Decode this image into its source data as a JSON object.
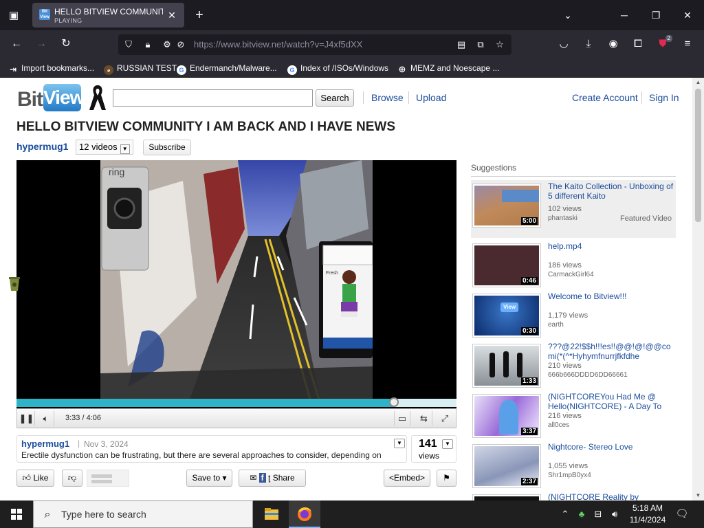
{
  "browser": {
    "tab": {
      "title": "HELLO BITVIEW COMMUNITY I AM BACK AND I HAVE NEWS",
      "status": "PLAYING",
      "favicon_text": "Bit View"
    },
    "url": "https://www.bitview.net/watch?v=J4xf5dXX",
    "extension_badge": "2",
    "bookmarks": [
      {
        "label": "Import bookmarks...",
        "icon": "import-icon"
      },
      {
        "label": "RUSSIAN TEST",
        "icon": "bear-icon"
      },
      {
        "label": "Endermanch/Malware...",
        "icon": "google-icon"
      },
      {
        "label": "Index of /ISOs/Windows",
        "icon": "google-icon"
      },
      {
        "label": "MEMZ and Noescape ...",
        "icon": "globe-icon"
      }
    ]
  },
  "site": {
    "logo_bit": "Bit",
    "logo_view": "View",
    "search_button": "Search",
    "nav": {
      "browse": "Browse",
      "upload": "Upload",
      "create_account": "Create Account",
      "sign_in": "Sign In"
    }
  },
  "video": {
    "title": "HELLO BITVIEW COMMUNITY I AM BACK AND I HAVE NEWS",
    "uploader": "hypermug1",
    "video_count": "12 videos",
    "subscribe": "Subscribe",
    "timecode": "3:33 / 4:06",
    "progress_fraction": 0.858,
    "upload_date": "Nov 3, 2024",
    "description": "Erectile dysfunction can be frustrating, but there are several approaches to consider, depending on",
    "views": "141",
    "views_label": "views",
    "overlay_text": {
      "ring": "ring",
      "fresh": "Fresh"
    }
  },
  "actions": {
    "like": "Like",
    "save_to": "Save to",
    "share": "Share",
    "embed": "<Embed>"
  },
  "suggestions": {
    "heading": "Suggestions",
    "items": [
      {
        "title": "The Kaito Collection - Unboxing of 5 different Kaito",
        "views": "102 views",
        "user": "phantaski",
        "duration": "5:00",
        "featured": "Featured Video"
      },
      {
        "title": "help.mp4",
        "views": "186 views",
        "user": "CarmackGirl64",
        "duration": "0:46"
      },
      {
        "title": "Welcome to Bitview!!!",
        "views": "1,179 views",
        "user": "earth",
        "duration": "0:30"
      },
      {
        "title": "???@22!$$h!!!es!!@@!@!@@comi(*(^*Hyhymfnurrjfkfdhe",
        "views": "210 views",
        "user": "666b666DDDD6DD66661",
        "duration": "1:33"
      },
      {
        "title": "(NIGHTCOREYou Had Me @ Hello(NIGHTCORE) - A Day To",
        "views": "216 views",
        "user": "all0ces",
        "duration": "3:37"
      },
      {
        "title": "Nightcore- Stereo Love",
        "views": "1,055 views",
        "user": "Shr1mpB0yx4",
        "duration": "2:37"
      },
      {
        "title": "(NIGHTCORE Reality by"
      }
    ]
  },
  "taskbar": {
    "search_placeholder": "Type here to search",
    "time": "5:18 AM",
    "date": "11/4/2024"
  }
}
